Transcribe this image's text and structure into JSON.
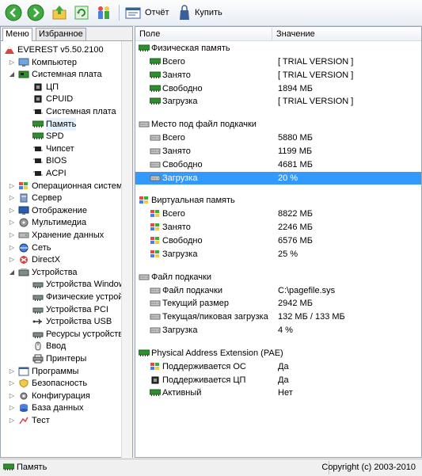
{
  "toolbar": {
    "report_label": "Отчёт",
    "buy_label": "Купить"
  },
  "left_panel": {
    "tabs": [
      "Меню",
      "Избранное"
    ],
    "tree": [
      {
        "label": "EVEREST v5.50.2100",
        "icon": "everest-logo-icon",
        "depth": 0,
        "arrow": ""
      },
      {
        "label": "Компьютер",
        "icon": "computer-icon",
        "depth": 1,
        "arrow": "right"
      },
      {
        "label": "Системная плата",
        "icon": "motherboard-icon",
        "depth": 1,
        "arrow": "down"
      },
      {
        "label": "ЦП",
        "icon": "cpu-icon",
        "depth": 2,
        "arrow": ""
      },
      {
        "label": "CPUID",
        "icon": "cpu-icon",
        "depth": 2,
        "arrow": ""
      },
      {
        "label": "Системная плата",
        "icon": "chip-icon",
        "depth": 2,
        "arrow": ""
      },
      {
        "label": "Память",
        "icon": "memory-icon",
        "depth": 2,
        "arrow": "",
        "selected": true
      },
      {
        "label": "SPD",
        "icon": "memory-icon",
        "depth": 2,
        "arrow": ""
      },
      {
        "label": "Чипсет",
        "icon": "chip-icon",
        "depth": 2,
        "arrow": ""
      },
      {
        "label": "BIOS",
        "icon": "chip-icon",
        "depth": 2,
        "arrow": ""
      },
      {
        "label": "ACPI",
        "icon": "chip-icon",
        "depth": 2,
        "arrow": ""
      },
      {
        "label": "Операционная система",
        "icon": "windows-icon",
        "depth": 1,
        "arrow": "right"
      },
      {
        "label": "Сервер",
        "icon": "server-icon",
        "depth": 1,
        "arrow": "right"
      },
      {
        "label": "Отображение",
        "icon": "monitor-icon",
        "depth": 1,
        "arrow": "right"
      },
      {
        "label": "Мультимедиа",
        "icon": "multimedia-icon",
        "depth": 1,
        "arrow": "right"
      },
      {
        "label": "Хранение данных",
        "icon": "storage-icon",
        "depth": 1,
        "arrow": "right"
      },
      {
        "label": "Сеть",
        "icon": "network-icon",
        "depth": 1,
        "arrow": "right"
      },
      {
        "label": "DirectX",
        "icon": "directx-icon",
        "depth": 1,
        "arrow": "right"
      },
      {
        "label": "Устройства",
        "icon": "devices-icon",
        "depth": 1,
        "arrow": "down"
      },
      {
        "label": "Устройства Windows",
        "icon": "device-icon",
        "depth": 2,
        "arrow": ""
      },
      {
        "label": "Физические устройств",
        "icon": "device-icon",
        "depth": 2,
        "arrow": ""
      },
      {
        "label": "Устройства PCI",
        "icon": "device-icon",
        "depth": 2,
        "arrow": ""
      },
      {
        "label": "Устройства USB",
        "icon": "usb-icon",
        "depth": 2,
        "arrow": ""
      },
      {
        "label": "Ресурсы устройств",
        "icon": "device-icon",
        "depth": 2,
        "arrow": ""
      },
      {
        "label": "Ввод",
        "icon": "mouse-icon",
        "depth": 2,
        "arrow": ""
      },
      {
        "label": "Принтеры",
        "icon": "printer-icon",
        "depth": 2,
        "arrow": ""
      },
      {
        "label": "Программы",
        "icon": "programs-icon",
        "depth": 1,
        "arrow": "right"
      },
      {
        "label": "Безопасность",
        "icon": "security-icon",
        "depth": 1,
        "arrow": "right"
      },
      {
        "label": "Конфигурация",
        "icon": "config-icon",
        "depth": 1,
        "arrow": "right"
      },
      {
        "label": "База данных",
        "icon": "database-icon",
        "depth": 1,
        "arrow": "right"
      },
      {
        "label": "Тест",
        "icon": "test-icon",
        "depth": 1,
        "arrow": "right"
      }
    ]
  },
  "right_panel": {
    "columns": [
      "Поле",
      "Значение"
    ],
    "sections": [
      {
        "title": "Физическая память",
        "icon": "memory-icon",
        "items": [
          {
            "field": "Всего",
            "value": "[ TRIAL VERSION ]",
            "icon": "memory-icon"
          },
          {
            "field": "Занято",
            "value": "[ TRIAL VERSION ]",
            "icon": "memory-icon"
          },
          {
            "field": "Свободно",
            "value": "1894 МБ",
            "icon": "memory-icon"
          },
          {
            "field": "Загрузка",
            "value": "[ TRIAL VERSION ]",
            "icon": "memory-icon"
          }
        ]
      },
      {
        "title": "Место под файл подкачки",
        "icon": "disk-icon",
        "items": [
          {
            "field": "Всего",
            "value": "5880 МБ",
            "icon": "disk-icon"
          },
          {
            "field": "Занято",
            "value": "1199 МБ",
            "icon": "disk-icon"
          },
          {
            "field": "Свободно",
            "value": "4681 МБ",
            "icon": "disk-icon"
          },
          {
            "field": "Загрузка",
            "value": "20 %",
            "icon": "disk-icon",
            "selected": true
          }
        ]
      },
      {
        "title": "Виртуальная память",
        "icon": "windows-icon",
        "items": [
          {
            "field": "Всего",
            "value": "8822 МБ",
            "icon": "windows-icon"
          },
          {
            "field": "Занято",
            "value": "2246 МБ",
            "icon": "windows-icon"
          },
          {
            "field": "Свободно",
            "value": "6576 МБ",
            "icon": "windows-icon"
          },
          {
            "field": "Загрузка",
            "value": "25 %",
            "icon": "windows-icon"
          }
        ]
      },
      {
        "title": "Файл подкачки",
        "icon": "disk-icon",
        "items": [
          {
            "field": "Файл подкачки",
            "value": "C:\\pagefile.sys",
            "icon": "disk-icon"
          },
          {
            "field": "Текущий размер",
            "value": "2942 МБ",
            "icon": "disk-icon"
          },
          {
            "field": "Текущая/пиковая загрузка",
            "value": "132 МБ / 133 МБ",
            "icon": "disk-icon"
          },
          {
            "field": "Загрузка",
            "value": "4 %",
            "icon": "disk-icon"
          }
        ]
      },
      {
        "title": "Physical Address Extension (PAE)",
        "icon": "memory-icon",
        "items": [
          {
            "field": "Поддерживается ОС",
            "value": "Да",
            "icon": "windows-icon"
          },
          {
            "field": "Поддерживается ЦП",
            "value": "Да",
            "icon": "cpu-icon"
          },
          {
            "field": "Активный",
            "value": "Нет",
            "icon": "memory-icon"
          }
        ]
      }
    ]
  },
  "status": {
    "left": "Память",
    "right": "Copyright (c) 2003-2010"
  },
  "colors": {
    "selection": "#3399ff",
    "tree_selection": "#e5f1fb"
  }
}
